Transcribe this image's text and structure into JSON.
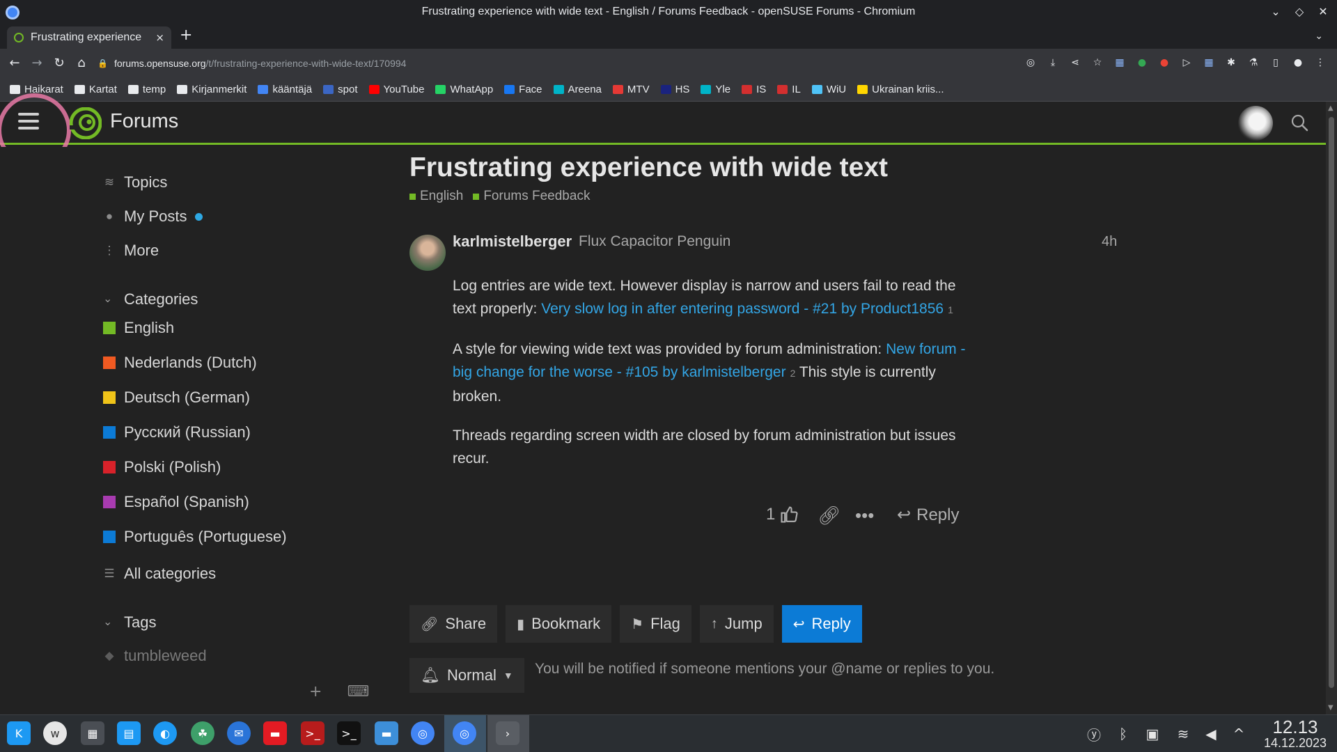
{
  "window": {
    "title": "Frustrating experience with wide text - English / Forums Feedback - openSUSE Forums - Chromium"
  },
  "tab": {
    "title": "Frustrating experience",
    "close": "×",
    "new": "+"
  },
  "address": {
    "host": "forums.opensuse.org",
    "path": "/t/frustrating-experience-with-wide-text/170994"
  },
  "bookmarks": [
    {
      "label": "Haikarat",
      "color": "#e8eaed"
    },
    {
      "label": "Kartat",
      "color": "#e8eaed"
    },
    {
      "label": "temp",
      "color": "#e8eaed"
    },
    {
      "label": "Kirjanmerkit",
      "color": "#e8eaed"
    },
    {
      "label": "kääntäjä",
      "color": "#4285f4"
    },
    {
      "label": "spot",
      "color": "#3b66c4"
    },
    {
      "label": "YouTube",
      "color": "#ff0000"
    },
    {
      "label": "WhatApp",
      "color": "#25d366"
    },
    {
      "label": "Face",
      "color": "#1877f2"
    },
    {
      "label": "Areena",
      "color": "#00b4c8"
    },
    {
      "label": "MTV",
      "color": "#e53935"
    },
    {
      "label": "HS",
      "color": "#1a237e"
    },
    {
      "label": "Yle",
      "color": "#00b4c8"
    },
    {
      "label": "IS",
      "color": "#d32f2f"
    },
    {
      "label": "IL",
      "color": "#d32f2f"
    },
    {
      "label": "WiU",
      "color": "#4fc3f7"
    },
    {
      "label": "Ukrainan kriis...",
      "color": "#ffd600"
    }
  ],
  "forum": {
    "title": "Forums"
  },
  "sidebar": {
    "nav": [
      {
        "label": "Topics",
        "icon": "layers-icon"
      },
      {
        "label": "My Posts",
        "icon": "user-icon"
      },
      {
        "label": "More",
        "icon": "more-vertical-icon"
      }
    ],
    "categories_header": "Categories",
    "categories": [
      {
        "label": "English",
        "color": "#73ba25"
      },
      {
        "label": "Nederlands (Dutch)",
        "color": "#f15a22"
      },
      {
        "label": "Deutsch (German)",
        "color": "#f0c419"
      },
      {
        "label": "Русский (Russian)",
        "color": "#0c7bd6"
      },
      {
        "label": "Polski (Polish)",
        "color": "#d8222a"
      },
      {
        "label": "Español (Spanish)",
        "color": "#a83bb0"
      },
      {
        "label": "Português (Portuguese)",
        "color": "#0c7bd6"
      }
    ],
    "all_categories": "All categories",
    "tags_header": "Tags",
    "tags": [
      "tumbleweed"
    ]
  },
  "topic": {
    "title": "Frustrating experience with wide text",
    "categories": [
      "English",
      "Forums Feedback"
    ]
  },
  "post": {
    "username": "karlmistelberger",
    "user_title": "Flux Capacitor Penguin",
    "age": "4h",
    "p1_text": "Log entries are wide text. However display is narrow and users fail to read the text properly: ",
    "p1_link": "Very slow log in after entering password - #21 by Product1856",
    "p1_clicks": "1",
    "p2_text": "A style for viewing wide text was provided by forum administration: ",
    "p2_link": "New forum - big change for the worse - #105 by karlmistelberger",
    "p2_clicks": "2",
    "p2_after": " This style is currently broken.",
    "p3_text": "Threads regarding screen width are closed by forum administration but issues recur.",
    "likes": "1",
    "reply_label": "Reply"
  },
  "footer_buttons": {
    "share": "Share",
    "bookmark": "Bookmark",
    "flag": "Flag",
    "jump": "Jump",
    "reply": "Reply"
  },
  "notification": {
    "level": "Normal",
    "description": "You will be notified if someone mentions your @name or replies to you."
  },
  "clock": {
    "time": "12.13",
    "date": "14.12.2023"
  }
}
